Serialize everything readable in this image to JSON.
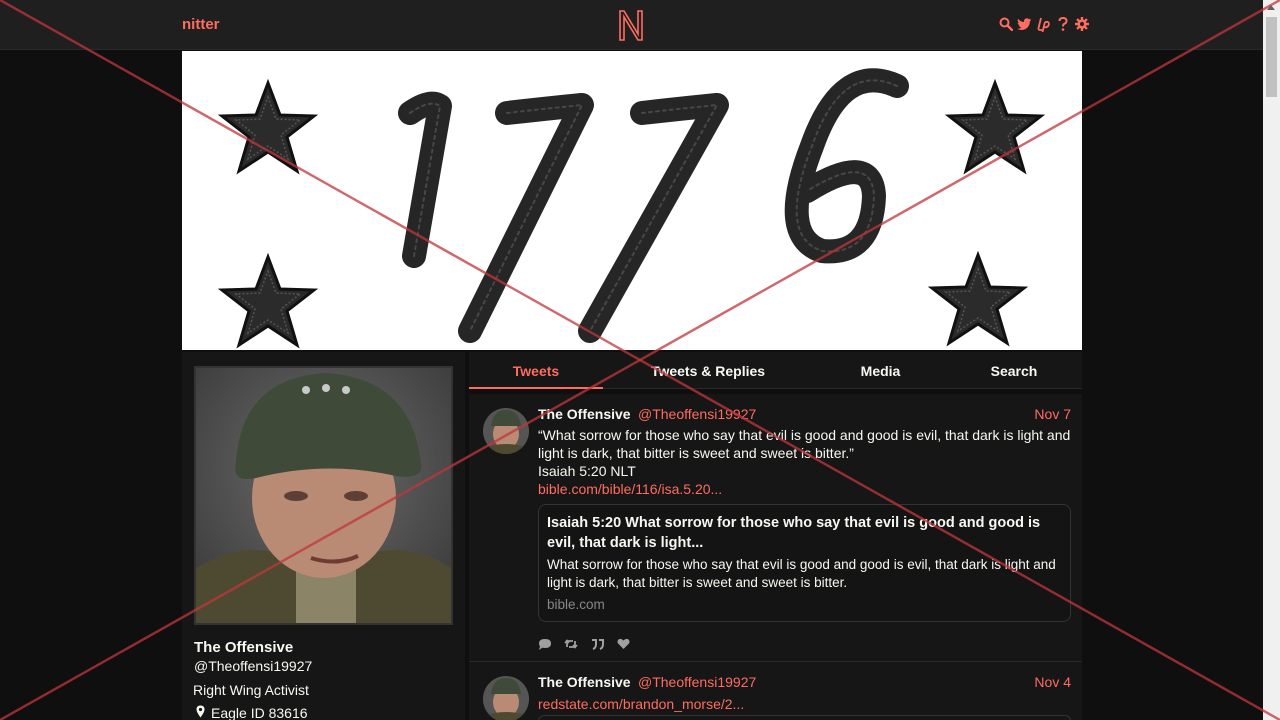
{
  "navbar": {
    "brand": "nitter",
    "logo_letter": "N",
    "icons": [
      "search-icon",
      "twitter-icon",
      "liberapay-icon",
      "help-icon",
      "gear-icon"
    ]
  },
  "banner": {
    "text": "1776",
    "alt": "banner"
  },
  "profile": {
    "fullname": "The Offensive",
    "username": "@Theoffensi19927",
    "bio": "Right Wing Activist",
    "location": "Eagle ID 83616"
  },
  "tabs": [
    {
      "label": "Tweets",
      "active": true
    },
    {
      "label": "Tweets & Replies",
      "active": false
    },
    {
      "label": "Media",
      "active": false
    },
    {
      "label": "Search",
      "active": false
    }
  ],
  "tweets": [
    {
      "fullname": "The Offensive",
      "username": "@Theoffensi19927",
      "date": "Nov 7",
      "line1": "“What sorrow for those who say that evil is good and good is evil, that dark is light and",
      "line2": "light is dark, that bitter is sweet and sweet is bitter.”",
      "line3": "Isaiah 5:20 NLT",
      "link": "bible.com/bible/116/isa.5.20...",
      "card": {
        "title": "Isaiah 5:20 What sorrow for those who say that evil is good and good is evil, that dark is light...",
        "description": "What sorrow for those who say that evil is good and good is evil, that dark is light and light is dark, that bitter is sweet and sweet is bitter.",
        "destination": "bible.com"
      },
      "stats_icons": [
        "comment-icon",
        "retweet-icon",
        "quote-icon",
        "heart-icon"
      ]
    },
    {
      "fullname": "The Offensive",
      "username": "@Theoffensi19927",
      "date": "Nov 4",
      "link": "redstate.com/brandon_morse/2..."
    }
  ],
  "colors": {
    "accent": "#ff6c60",
    "background": "#0f0f0f",
    "panel": "#161616",
    "navbar": "#1f1f1f",
    "overlay_x": "#c0363b"
  }
}
